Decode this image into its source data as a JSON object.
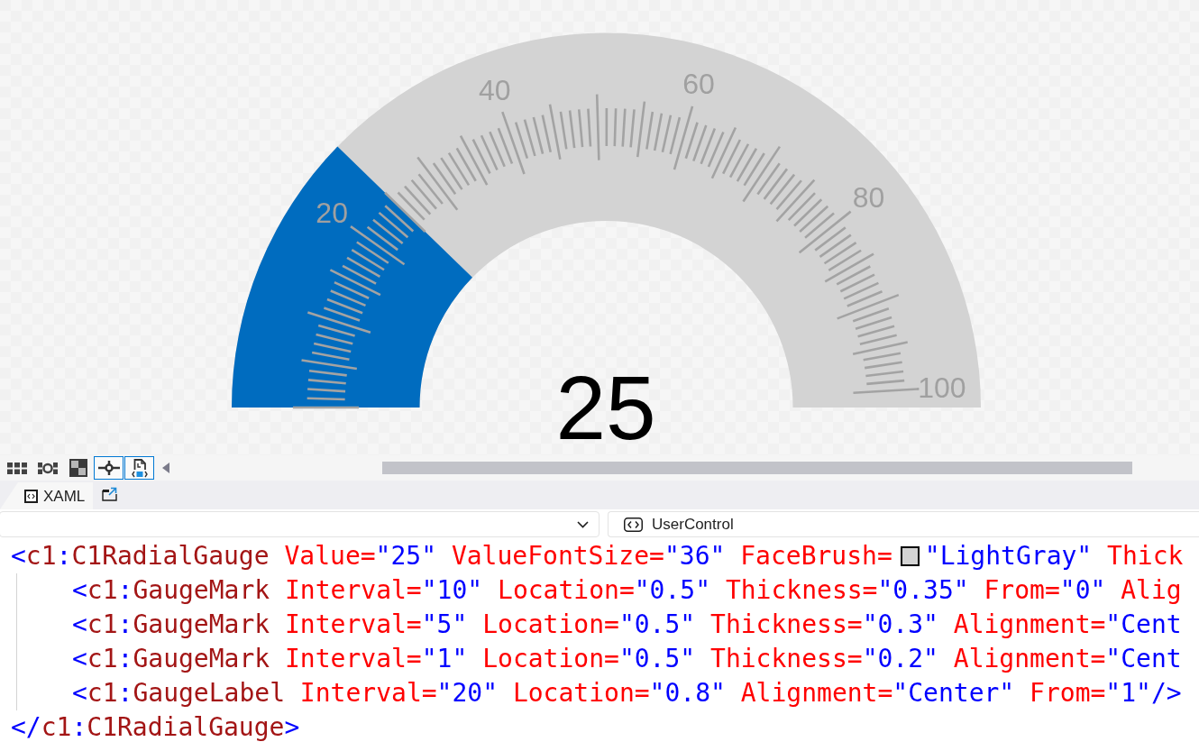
{
  "designer": {
    "gauge": {
      "level": 0.25,
      "value": "25",
      "labels": [
        "20",
        "40",
        "60",
        "80",
        "100"
      ]
    },
    "toolbar": {
      "buttons": [
        {
          "kind": "grid",
          "selected": false
        },
        {
          "kind": "ring_grid",
          "selected": false
        },
        {
          "kind": "checkerboard",
          "selected": false
        },
        {
          "kind": "crosshair",
          "selected": true
        },
        {
          "kind": "document",
          "selected": true
        }
      ]
    }
  },
  "tabs": [
    {
      "label": "XAML",
      "selected": true
    }
  ],
  "navigation_bar": {
    "member": "UserControl"
  },
  "code": {
    "lines": [
      {
        "segments": [
          {
            "kind": "text",
            "tokens": [
              {
                "kind": "bracket",
                "text": "<"
              },
              {
                "kind": "name",
                "text": "c1"
              },
              {
                "kind": "bracket",
                "text": ":"
              },
              {
                "kind": "name",
                "text": "C1RadialGauge"
              },
              {
                "kind": "attribute",
                "text": " Value="
              },
              {
                "kind": "value",
                "text": "\"25\""
              },
              {
                "kind": "attribute",
                "text": " ValueFontSize="
              },
              {
                "kind": "value",
                "text": "\"36\""
              },
              {
                "kind": "attribute",
                "text": " FaceBrush="
              }
            ]
          },
          {
            "kind": "swatch",
            "color": "#d3d3d3"
          },
          {
            "kind": "text",
            "tokens": [
              {
                "kind": "value",
                "text": "\"LightGray\""
              },
              {
                "kind": "attribute",
                "text": " Thick"
              }
            ]
          }
        ],
        "children": [
          {
            "segments": [
              {
                "kind": "text",
                "tokens": [
                  {
                    "kind": "bracket",
                    "text": "<"
                  },
                  {
                    "kind": "name",
                    "text": "c1"
                  },
                  {
                    "kind": "bracket",
                    "text": ":"
                  },
                  {
                    "kind": "name",
                    "text": "GaugeMark"
                  },
                  {
                    "kind": "attribute",
                    "text": " Interval="
                  },
                  {
                    "kind": "value",
                    "text": "\"10\""
                  },
                  {
                    "kind": "attribute",
                    "text": " Location="
                  },
                  {
                    "kind": "value",
                    "text": "\"0.5\""
                  },
                  {
                    "kind": "attribute",
                    "text": " Thickness="
                  },
                  {
                    "kind": "value",
                    "text": "\"0.35\""
                  },
                  {
                    "kind": "attribute",
                    "text": " From="
                  },
                  {
                    "kind": "value",
                    "text": "\"0\""
                  },
                  {
                    "kind": "attribute",
                    "text": " Alig"
                  }
                ]
              }
            ]
          },
          {
            "segments": [
              {
                "kind": "text",
                "tokens": [
                  {
                    "kind": "bracket",
                    "text": "<"
                  },
                  {
                    "kind": "name",
                    "text": "c1"
                  },
                  {
                    "kind": "bracket",
                    "text": ":"
                  },
                  {
                    "kind": "name",
                    "text": "GaugeMark"
                  },
                  {
                    "kind": "attribute",
                    "text": " Interval="
                  },
                  {
                    "kind": "value",
                    "text": "\"5\""
                  },
                  {
                    "kind": "attribute",
                    "text": " Location="
                  },
                  {
                    "kind": "value",
                    "text": "\"0.5\""
                  },
                  {
                    "kind": "attribute",
                    "text": " Thickness="
                  },
                  {
                    "kind": "value",
                    "text": "\"0.3\""
                  },
                  {
                    "kind": "attribute",
                    "text": " Alignment="
                  },
                  {
                    "kind": "value",
                    "text": "\"Cent"
                  }
                ]
              }
            ]
          },
          {
            "segments": [
              {
                "kind": "text",
                "tokens": [
                  {
                    "kind": "bracket",
                    "text": "<"
                  },
                  {
                    "kind": "name",
                    "text": "c1"
                  },
                  {
                    "kind": "bracket",
                    "text": ":"
                  },
                  {
                    "kind": "name",
                    "text": "GaugeMark"
                  },
                  {
                    "kind": "attribute",
                    "text": " Interval="
                  },
                  {
                    "kind": "value",
                    "text": "\"1\""
                  },
                  {
                    "kind": "attribute",
                    "text": " Location="
                  },
                  {
                    "kind": "value",
                    "text": "\"0.5\""
                  },
                  {
                    "kind": "attribute",
                    "text": " Thickness="
                  },
                  {
                    "kind": "value",
                    "text": "\"0.2\""
                  },
                  {
                    "kind": "attribute",
                    "text": " Alignment="
                  },
                  {
                    "kind": "value",
                    "text": "\"Cent"
                  }
                ]
              }
            ]
          },
          {
            "segments": [
              {
                "kind": "text",
                "tokens": [
                  {
                    "kind": "bracket",
                    "text": "<"
                  },
                  {
                    "kind": "name",
                    "text": "c1"
                  },
                  {
                    "kind": "bracket",
                    "text": ":"
                  },
                  {
                    "kind": "name",
                    "text": "GaugeLabel"
                  },
                  {
                    "kind": "attribute",
                    "text": " Interval="
                  },
                  {
                    "kind": "value",
                    "text": "\"20\""
                  },
                  {
                    "kind": "attribute",
                    "text": " Location="
                  },
                  {
                    "kind": "value",
                    "text": "\"0.8\""
                  },
                  {
                    "kind": "attribute",
                    "text": " Alignment="
                  },
                  {
                    "kind": "value",
                    "text": "\"Center\""
                  },
                  {
                    "kind": "attribute",
                    "text": " From="
                  },
                  {
                    "kind": "value",
                    "text": "\"1\""
                  },
                  {
                    "kind": "bracket",
                    "text": "/>"
                  }
                ]
              }
            ]
          }
        ]
      },
      {
        "segments": [
          {
            "kind": "text",
            "tokens": [
              {
                "kind": "bracket",
                "text": "</"
              },
              {
                "kind": "name",
                "text": "c1"
              },
              {
                "kind": "bracket",
                "text": ":"
              },
              {
                "kind": "name",
                "text": "C1RadialGauge"
              },
              {
                "kind": "bracket",
                "text": ">"
              }
            ]
          }
        ]
      }
    ]
  }
}
